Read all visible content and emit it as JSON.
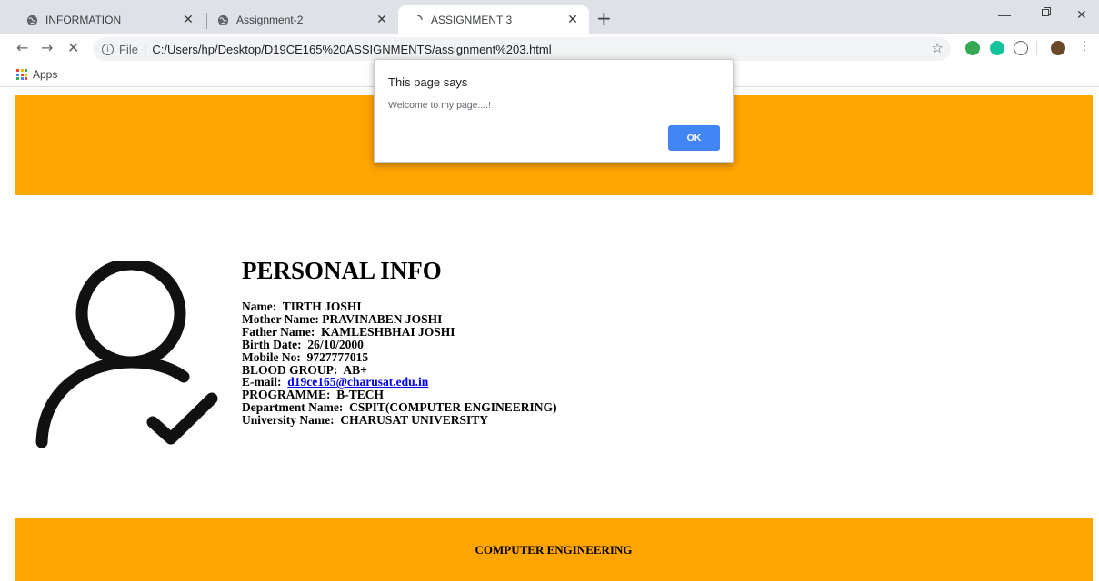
{
  "tabs": [
    {
      "title": "INFORMATION",
      "active": false
    },
    {
      "title": "Assignment-2",
      "active": false
    },
    {
      "title": "ASSIGNMENT 3",
      "active": true
    }
  ],
  "toolbar": {
    "file_label": "File",
    "url": "C:/Users/hp/Desktop/D19CE165%20ASSIGNMENTS/assignment%203.html"
  },
  "bookmarks": {
    "apps_label": "Apps"
  },
  "dialog": {
    "title": "This page says",
    "message": "Welcome to my page....!",
    "ok_label": "OK"
  },
  "page": {
    "heading": "PERSONAL INFO",
    "fields": [
      {
        "label": "Name:",
        "value": "TIRTH JOSHI"
      },
      {
        "label": "Mother Name:",
        "value": "PRAVINABEN JOSHI"
      },
      {
        "label": "Father Name:",
        "value": "KAMLESHBHAI JOSHI"
      },
      {
        "label": "Birth Date:",
        "value": "26/10/2000"
      },
      {
        "label": "Mobile No:",
        "value": "9727777015"
      },
      {
        "label": "BLOOD GROUP:",
        "value": "AB+"
      },
      {
        "label": "E-mail:",
        "value": "d19ce165@charusat.edu.in"
      },
      {
        "label": "PROGRAMME:",
        "value": "B-TECH"
      },
      {
        "label": "Department Name:",
        "value": "CSPIT(COMPUTER ENGINEERING)"
      },
      {
        "label": "University Name:",
        "value": "CHARUSAT UNIVERSITY"
      }
    ],
    "footer": "COMPUTER ENGINEERING"
  },
  "colors": {
    "band": "#ffa500",
    "tabstrip": "#dee1e6",
    "ok_button": "#4285f4",
    "link": "#0000ee"
  },
  "icons": [
    "globe-icon",
    "close-icon",
    "loading-icon",
    "new-tab-icon",
    "minimize-icon",
    "restore-icon",
    "window-close-icon",
    "back-icon",
    "forward-icon",
    "stop-icon",
    "info-icon",
    "star-icon",
    "apps-grid-icon",
    "user-check-icon"
  ]
}
